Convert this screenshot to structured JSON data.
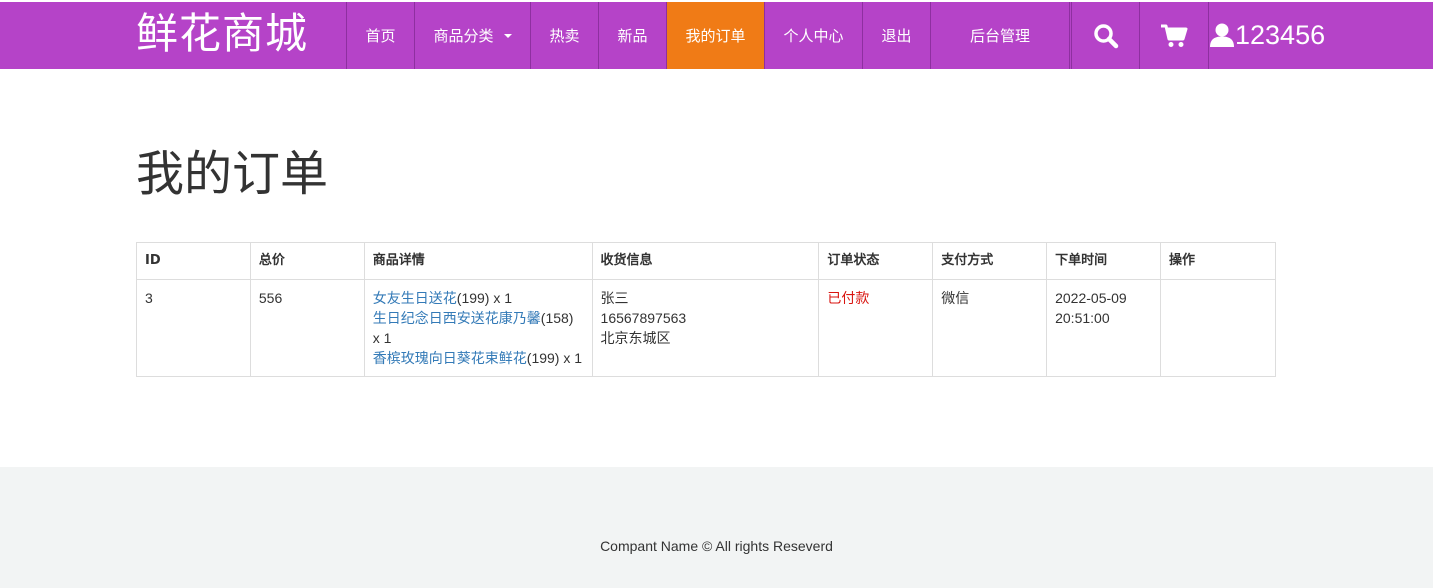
{
  "nav": {
    "brand": "鲜花商城",
    "items": [
      {
        "label": "首页"
      },
      {
        "label": "商品分类"
      },
      {
        "label": "热卖"
      },
      {
        "label": "新品"
      },
      {
        "label": "我的订单"
      },
      {
        "label": "个人中心"
      },
      {
        "label": "退出"
      },
      {
        "label": "后台管理"
      }
    ],
    "username": "123456",
    "colors": {
      "bar": "#b543c8",
      "active": "#f07b16"
    }
  },
  "page": {
    "title": "我的订单"
  },
  "orders": {
    "headers": [
      "ID",
      "总价",
      "商品详情",
      "收货信息",
      "订单状态",
      "支付方式",
      "下单时间",
      "操作"
    ],
    "rows": [
      {
        "id": "3",
        "total": "556",
        "items": [
          {
            "name": "女友生日送花",
            "qty": "(199) x 1"
          },
          {
            "name": "生日纪念日西安送花康乃馨",
            "qty": "(158) x 1"
          },
          {
            "name": "香槟玫瑰向日葵花束鲜花",
            "qty": "(199) x 1"
          }
        ],
        "recipient": "张三",
        "phone": "16567897563",
        "address": "北京东城区",
        "status": "已付款",
        "payment": "微信",
        "date": "2022-05-09",
        "time": "20:51:00",
        "action": ""
      }
    ]
  },
  "footer": {
    "text": "Compant Name © All rights Reseverd"
  }
}
